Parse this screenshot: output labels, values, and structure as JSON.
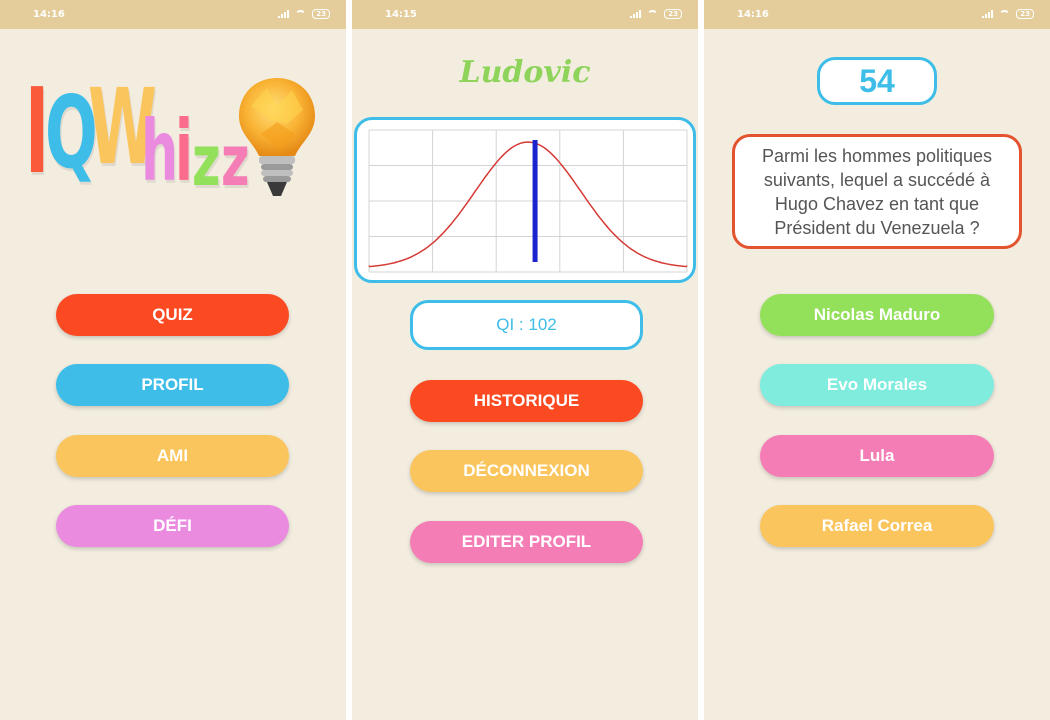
{
  "status": {
    "screen1_time": "14:16",
    "screen2_time": "14:15",
    "screen3_time": "14:16",
    "battery": "23"
  },
  "home": {
    "logo_letters": [
      "I",
      "Q",
      "W",
      "h",
      "i",
      "z",
      "z"
    ],
    "buttons": {
      "quiz": "QUIZ",
      "profil": "PROFIL",
      "ami": "AMI",
      "defi": "DÉFI"
    }
  },
  "profile": {
    "username": "Ludovic",
    "iq_label": "QI : 102",
    "buttons": {
      "historique": "HISTORIQUE",
      "deconnexion": "DÉCONNEXION",
      "editer": "EDITER PROFIL"
    }
  },
  "chart_data": {
    "type": "line",
    "series": [
      {
        "values": [
          0.02,
          0.05,
          0.14,
          0.33,
          0.61,
          0.88,
          1.0,
          0.88,
          0.61,
          0.33,
          0.14,
          0.05,
          0.02
        ]
      }
    ],
    "x": [
      55,
      62.5,
      70,
      77.5,
      85,
      92.5,
      100,
      107.5,
      115,
      122.5,
      130,
      137.5,
      145
    ],
    "marker_x": 102,
    "grid": true
  },
  "quiz": {
    "timer": "54",
    "question": "Parmi les hommes politiques suivants, lequel a succédé à Hugo Chavez en tant que Président du Venezuela ?",
    "answers": [
      "Nicolas Maduro",
      "Evo Morales",
      "Lula",
      "Rafael Correa"
    ]
  },
  "colors": {
    "orange": "#fb4a22",
    "blue": "#3dbde8",
    "yellow": "#fbc55d",
    "pink": "#ea8be0",
    "hotpink": "#f57db5",
    "green": "#93e05b",
    "aqua": "#7fecde",
    "curve": "#d53a35",
    "marker": "#1a24cc"
  }
}
